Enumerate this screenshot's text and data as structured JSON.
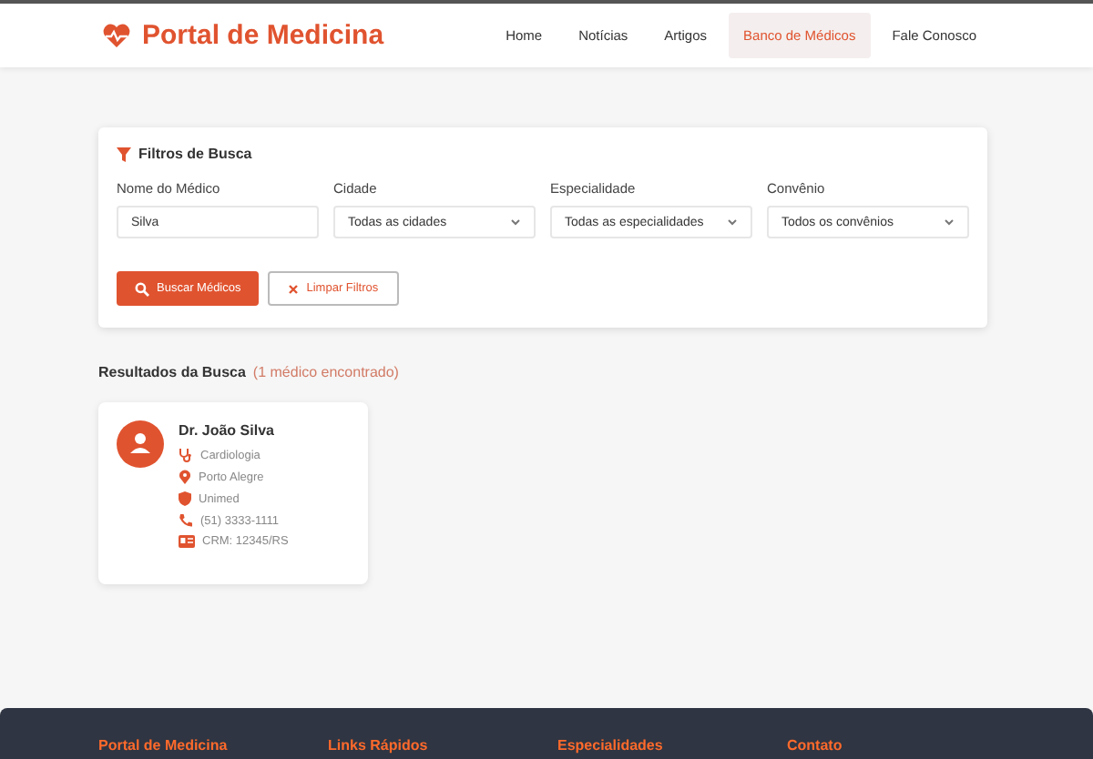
{
  "header": {
    "logo": "Portal de Medicina",
    "nav": [
      {
        "label": "Home",
        "selected": false
      },
      {
        "label": "Notícias",
        "selected": false
      },
      {
        "label": "Artigos",
        "selected": false
      },
      {
        "label": "Banco de Médicos",
        "selected": true
      },
      {
        "label": "Fale Conosco",
        "selected": false
      }
    ]
  },
  "filters": {
    "title": "Filtros de Busca",
    "fields": [
      {
        "label": "Nome do Médico",
        "kind": "text",
        "value": "Silva"
      },
      {
        "label": "Cidade",
        "kind": "select",
        "value": "Todas as cidades"
      },
      {
        "label": "Especialidade",
        "kind": "select",
        "value": "Todas as especialidades"
      },
      {
        "label": "Convênio",
        "kind": "select",
        "value": "Todos os convênios"
      }
    ],
    "search_button": "Buscar Médicos",
    "clear_button": "Limpar Filtros"
  },
  "results": {
    "title": "Resultados da Busca",
    "count": "(1 médico encontrado)",
    "doctors": [
      {
        "name": "Dr. João Silva",
        "details": [
          {
            "kind": "specialty",
            "text": "Cardiologia"
          },
          {
            "kind": "city",
            "text": "Porto Alegre"
          },
          {
            "kind": "insurance",
            "text": "Unimed"
          },
          {
            "kind": "phone",
            "text": "(51) 3333-1111"
          },
          {
            "kind": "crm",
            "text": "CRM: 12345/RS"
          }
        ]
      }
    ]
  },
  "footer": {
    "headings": [
      "Portal de Medicina",
      "Links Rápidos",
      "Especialidades",
      "Contato"
    ]
  }
}
